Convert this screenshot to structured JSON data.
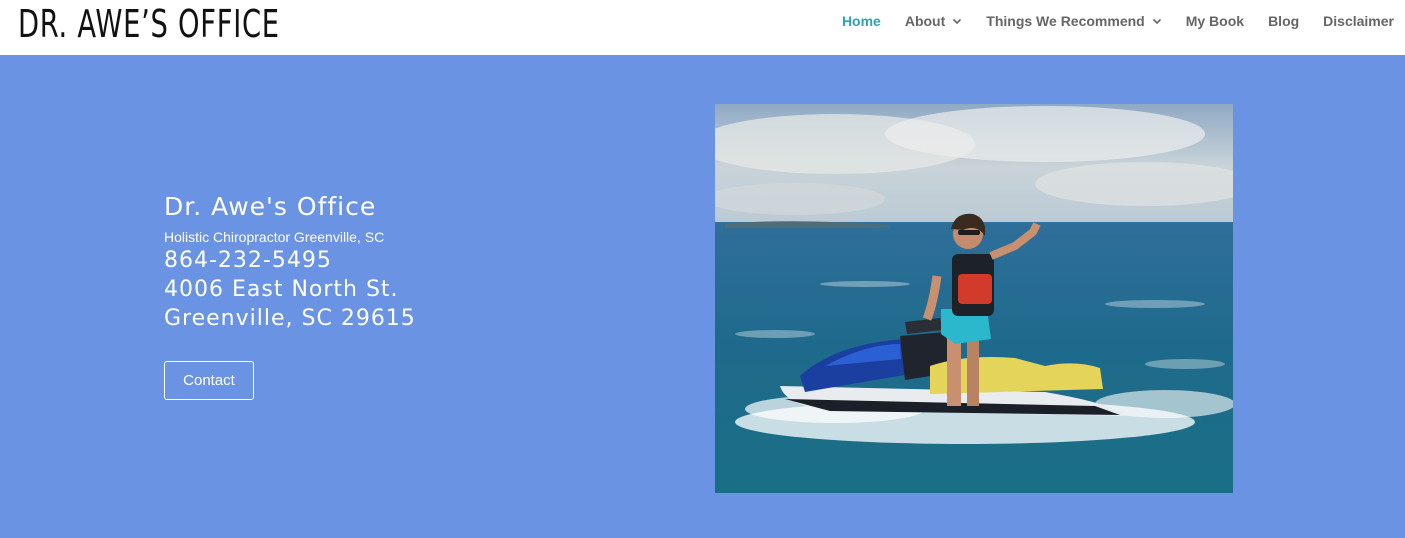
{
  "header": {
    "logo": "DR. AWE’S OFFICE",
    "nav": [
      {
        "label": "Home",
        "active": true,
        "dropdown": false
      },
      {
        "label": "About",
        "active": false,
        "dropdown": true
      },
      {
        "label": "Things We Recommend",
        "active": false,
        "dropdown": true
      },
      {
        "label": "My Book",
        "active": false,
        "dropdown": false
      },
      {
        "label": "Blog",
        "active": false,
        "dropdown": false
      },
      {
        "label": "Disclaimer",
        "active": false,
        "dropdown": false
      }
    ]
  },
  "hero": {
    "title": "Dr. Awe's Office",
    "subtitle": "Holistic Chiropractor Greenville, SC",
    "phone": "864-232-5495",
    "address_line1": "4006 East North St.",
    "address_line2": "Greenville, SC 29615",
    "contact_label": "Contact",
    "photo_icon": "jet-ski-photo"
  },
  "colors": {
    "hero_bg": "#6b93e3",
    "header_bg": "#ffffff",
    "nav_active": "#2ea3b6",
    "nav_text": "#666666"
  }
}
